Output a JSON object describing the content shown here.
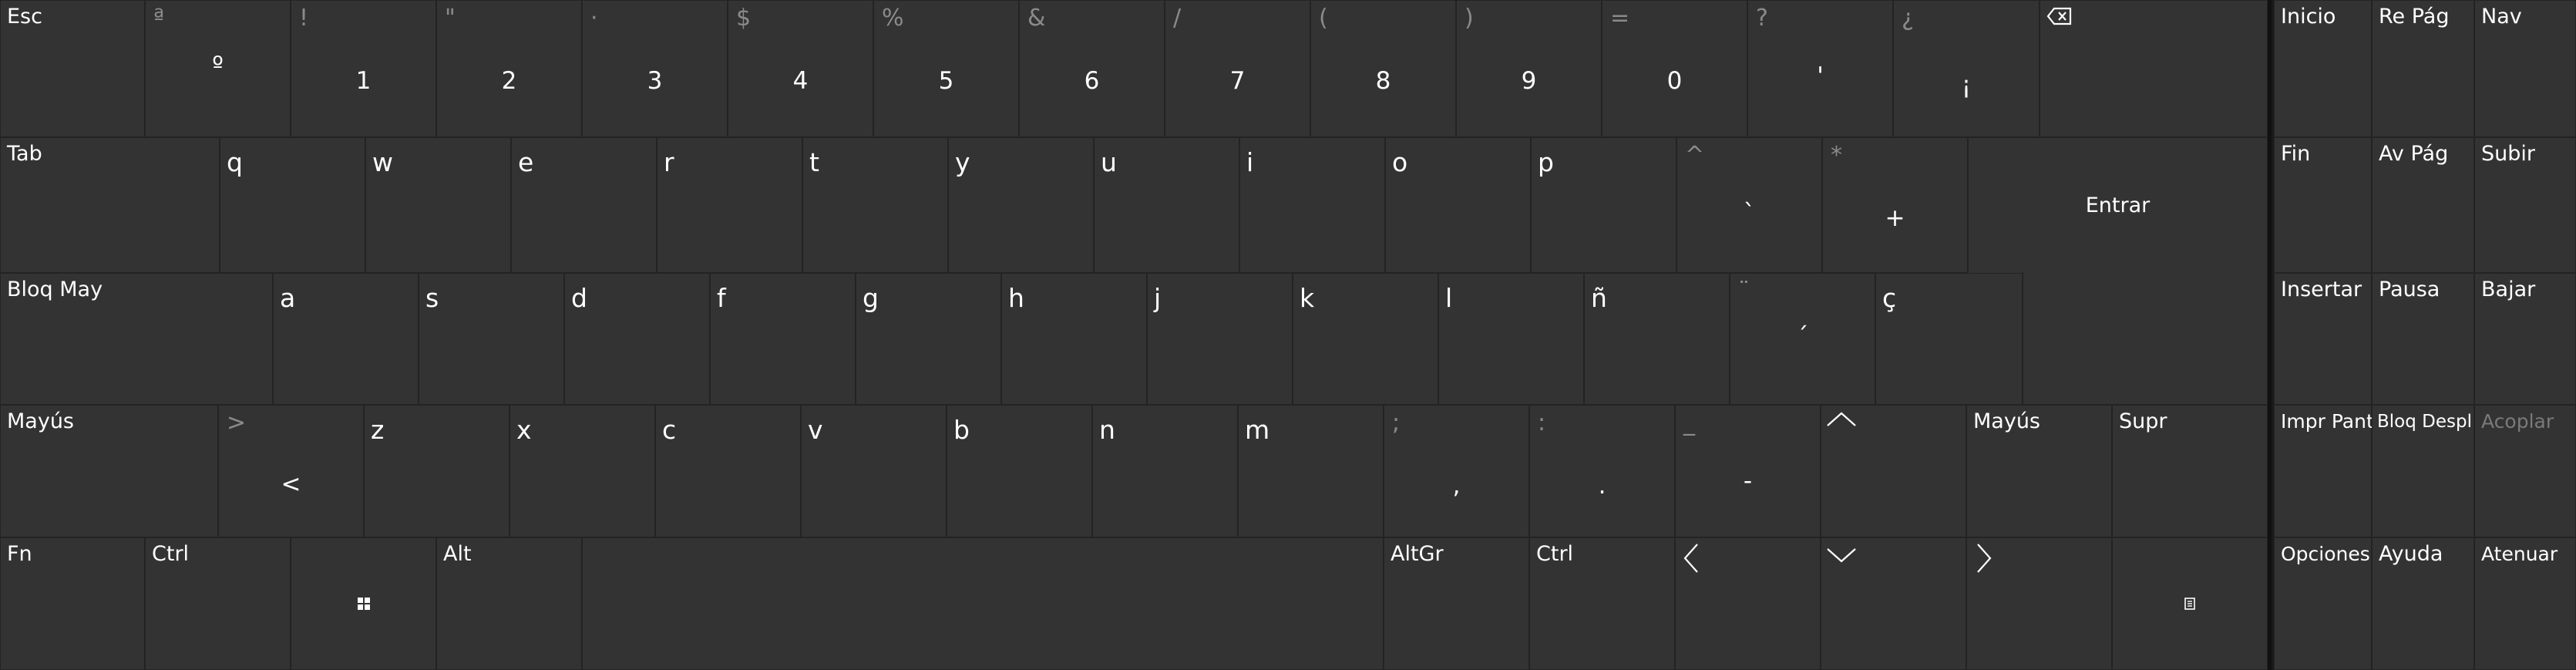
{
  "colors": {
    "background": "#1a1a1a",
    "key": "#333333",
    "text": "#ffffff",
    "secondary_text": "#8a8a8a",
    "disabled_text": "#7a7a7a"
  },
  "icons": {
    "backspace": "backspace-icon",
    "windows": "windows-logo-icon",
    "menu": "context-menu-icon",
    "arrows": [
      "chevron-up-icon",
      "chevron-left-icon",
      "chevron-down-icon",
      "chevron-right-icon"
    ]
  },
  "row1": {
    "esc": "Esc",
    "k0": {
      "shift": "ª",
      "main": "º"
    },
    "k1": {
      "shift": "!",
      "main": "1"
    },
    "k2": {
      "shift": "\"",
      "main": "2"
    },
    "k3": {
      "shift": "·",
      "main": "3"
    },
    "k4": {
      "shift": "$",
      "main": "4"
    },
    "k5": {
      "shift": "%",
      "main": "5"
    },
    "k6": {
      "shift": "&",
      "main": "6"
    },
    "k7": {
      "shift": "/",
      "main": "7"
    },
    "k8": {
      "shift": "(",
      "main": "8"
    },
    "k9": {
      "shift": ")",
      "main": "9"
    },
    "k10": {
      "shift": "=",
      "main": "0"
    },
    "k11": {
      "shift": "?",
      "main": "'"
    },
    "k12": {
      "shift": "¿",
      "main": "¡"
    }
  },
  "row2": {
    "tab": "Tab",
    "letters": [
      "q",
      "w",
      "e",
      "r",
      "t",
      "y",
      "u",
      "i",
      "o",
      "p"
    ],
    "grave": {
      "shift": "^",
      "main": "`"
    },
    "plus": {
      "shift": "*",
      "main": "+"
    },
    "enter": "Entrar"
  },
  "row3": {
    "caps": "Bloq May",
    "letters": [
      "a",
      "s",
      "d",
      "f",
      "g",
      "h",
      "j",
      "k",
      "l",
      "ñ"
    ],
    "acute": {
      "shift": "¨",
      "main": "´"
    },
    "cedilla": "ç"
  },
  "row4": {
    "shift_left": "Mayús",
    "angle": {
      "shift": ">",
      "main": "<"
    },
    "letters": [
      "z",
      "x",
      "c",
      "v",
      "b",
      "n",
      "m"
    ],
    "comma": {
      "shift": ";",
      "main": ","
    },
    "period": {
      "shift": ":",
      "main": "."
    },
    "minus": {
      "shift": "_",
      "main": "-"
    },
    "shift_right": "Mayús",
    "supr": "Supr"
  },
  "row5": {
    "fn": "Fn",
    "ctrl_left": "Ctrl",
    "alt": "Alt",
    "altgr": "AltGr",
    "ctrl_right": "Ctrl"
  },
  "nav": {
    "inicio": "Inicio",
    "repag": "Re Pág",
    "nav": "Nav",
    "fin": "Fin",
    "avpag": "Av Pág",
    "subir": "Subir",
    "insertar": "Insertar",
    "pausa": "Pausa",
    "bajar": "Bajar",
    "imprpant": "Impr Pant",
    "bloqdespl": "Bloq Despl",
    "acoplar": "Acoplar",
    "opciones": "Opciones",
    "ayuda": "Ayuda",
    "atenuar": "Atenuar"
  }
}
